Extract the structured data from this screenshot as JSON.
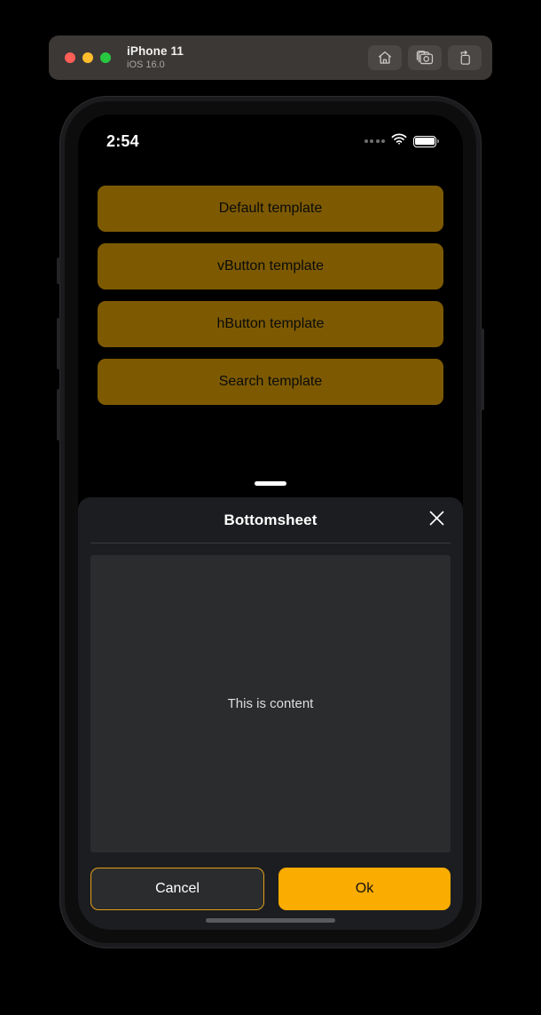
{
  "simulator": {
    "device_name": "iPhone 11",
    "os_version": "iOS 16.0",
    "window_controls": [
      "close",
      "minimize",
      "zoom"
    ],
    "actions": [
      {
        "name": "home-icon",
        "label": "Home"
      },
      {
        "name": "screenshot-icon",
        "label": "Screenshot"
      },
      {
        "name": "rotate-icon",
        "label": "Rotate"
      }
    ],
    "colors": {
      "titlebar_bg": "#3b3836",
      "close_dot": "#ff5f57",
      "minimize_dot": "#febc2e",
      "zoom_dot": "#28c840"
    }
  },
  "status_bar": {
    "time": "2:54",
    "cellular": "4 dots",
    "wifi": "wifi-icon",
    "battery": "battery-full-icon"
  },
  "screen": {
    "background": "#000000",
    "template_buttons": [
      {
        "label": "Default template"
      },
      {
        "label": "vButton template"
      },
      {
        "label": "hButton template"
      },
      {
        "label": "Search template"
      }
    ],
    "template_button_color": "#7d5a02",
    "template_button_text_color": "#0b0b0b"
  },
  "bottomsheet": {
    "drag_handle": true,
    "title": "Bottomsheet",
    "close_icon": "close-x-icon",
    "content_text": "This is content",
    "content_background": "#2b2c2e",
    "sheet_background": "#1c1d20",
    "actions": {
      "cancel_label": "Cancel",
      "ok_label": "Ok",
      "cancel_border_color": "#e2a017",
      "ok_background": "#fbac01",
      "ok_text_color": "#131313"
    },
    "home_indicator": true
  }
}
